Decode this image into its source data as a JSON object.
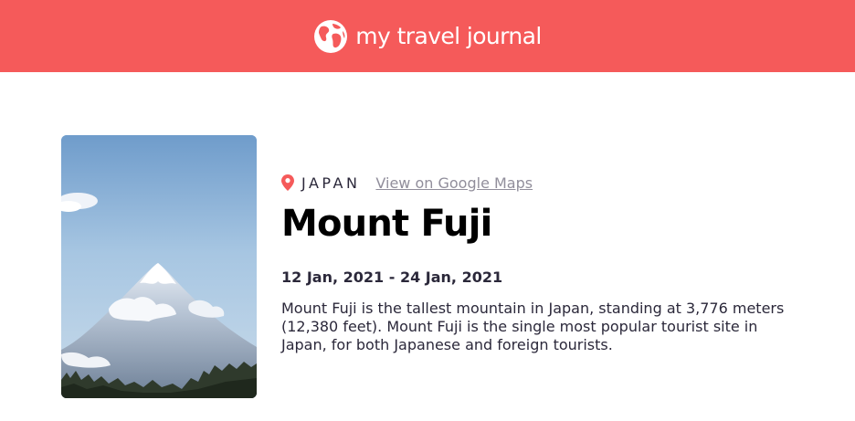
{
  "header": {
    "brand_text": "my travel journal",
    "icon": "globe-icon",
    "background_color": "#f55a5a"
  },
  "entry": {
    "image": {
      "subject": "mountain-photo"
    },
    "location": {
      "icon": "map-pin-icon",
      "country": "JAPAN",
      "maps_link_label": "View on Google Maps"
    },
    "title": "Mount Fuji",
    "dates": "12 Jan, 2021 - 24 Jan, 2021",
    "description": "Mount Fuji is the tallest mountain in Japan, standing at 3,776 meters (12,380 feet). Mount Fuji is the single most popular tourist site in Japan, for both Japanese and foreign tourists."
  },
  "colors": {
    "accent": "#f55a5a",
    "link": "#918e9b",
    "text": "#2b283a"
  }
}
